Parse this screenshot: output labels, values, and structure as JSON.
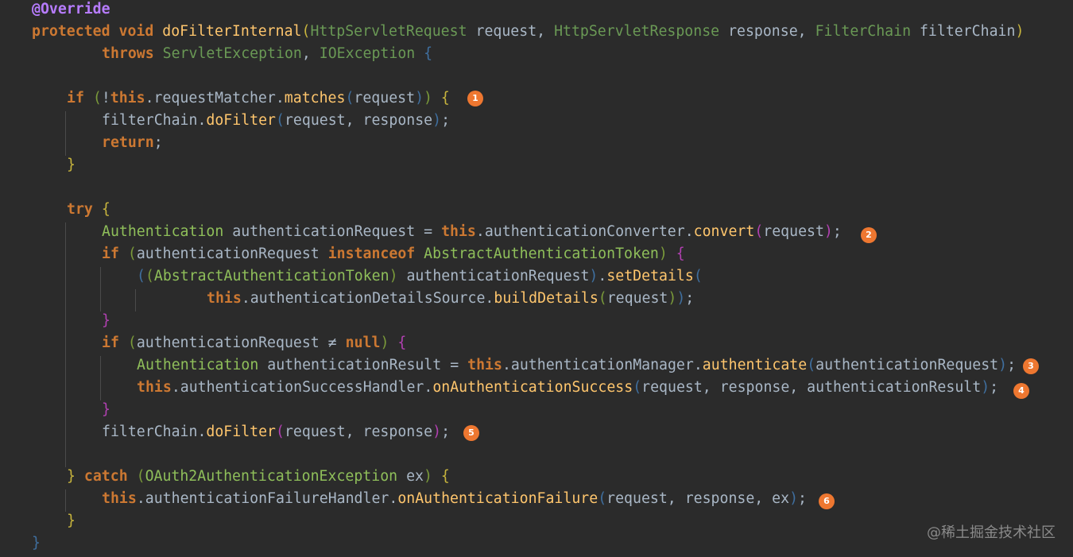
{
  "code": {
    "l1_annotation": "@Override",
    "l2_protected": "protected",
    "l2_void": "void",
    "l2_method": "doFilterInternal",
    "l2_type1": "HttpServletRequest",
    "l2_param1": "request",
    "l2_type2": "HttpServletResponse",
    "l2_param2": "response",
    "l2_type3": "FilterChain",
    "l2_param3": "filterChain",
    "l3_throws": "throws",
    "l3_exc1": "ServletException",
    "l3_exc2": "IOException",
    "l4_if": "if",
    "l4_this": "this",
    "l4_field": "requestMatcher",
    "l4_method": "matches",
    "l4_arg": "request",
    "l5_obj": "filterChain",
    "l5_method": "doFilter",
    "l5_args": "request, response",
    "l6_return": "return",
    "l8_try": "try",
    "l9_type": "Authentication",
    "l9_var": "authenticationRequest",
    "l9_this": "this",
    "l9_field": "authenticationConverter",
    "l9_method": "convert",
    "l9_arg": "request",
    "l10_if": "if",
    "l10_var": "authenticationRequest",
    "l10_instanceof": "instanceof",
    "l10_type": "AbstractAuthenticationToken",
    "l11_cast": "AbstractAuthenticationToken",
    "l11_var": "authenticationRequest",
    "l11_method": "setDetails",
    "l12_this": "this",
    "l12_field": "authenticationDetailsSource",
    "l12_method": "buildDetails",
    "l12_arg": "request",
    "l14_if": "if",
    "l14_var": "authenticationRequest",
    "l14_op": "≠",
    "l14_null": "null",
    "l15_type": "Authentication",
    "l15_var": "authenticationResult",
    "l15_this": "this",
    "l15_field": "authenticationManager",
    "l15_method": "authenticate",
    "l15_arg": "authenticationRequest",
    "l16_this": "this",
    "l16_field": "authenticationSuccessHandler",
    "l16_method": "onAuthenticationSuccess",
    "l16_args": "request, response, authenticationResult",
    "l18_obj": "filterChain",
    "l18_method": "doFilter",
    "l18_args": "request, response",
    "l20_catch": "catch",
    "l20_type": "OAuth2AuthenticationException",
    "l20_var": "ex",
    "l21_this": "this",
    "l21_field": "authenticationFailureHandler",
    "l21_method": "onAuthenticationFailure",
    "l21_args": "request, response, ex"
  },
  "badges": [
    "1",
    "2",
    "3",
    "4",
    "5",
    "6"
  ],
  "watermark": "@稀土掘金技术社区",
  "colors": {
    "background": "#2b2b2b",
    "keyword": "#cc7832",
    "annotation": "#b77cff",
    "method": "#ffc66d",
    "type": "#6a9955",
    "text": "#a9b7c6",
    "badge": "#ee7730"
  }
}
